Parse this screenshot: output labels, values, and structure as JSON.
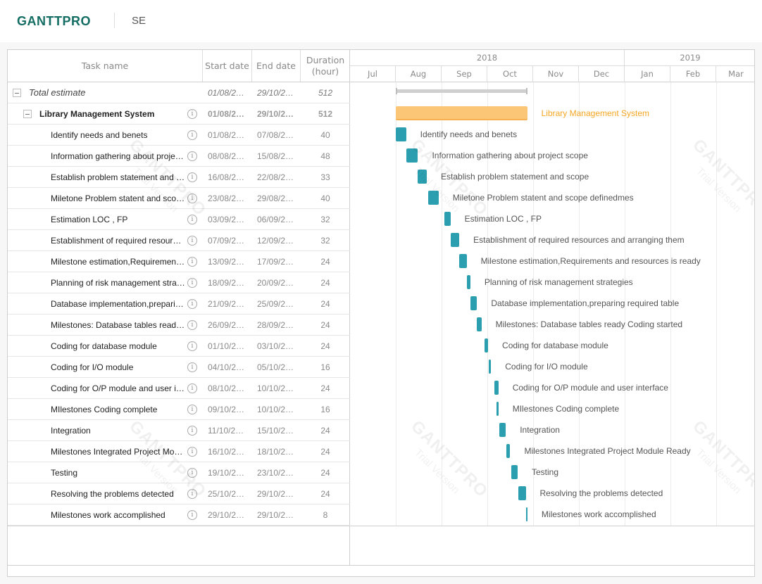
{
  "header": {
    "logo": "GANTTPRO",
    "project_code": "SE"
  },
  "columns": {
    "task_name": "Task name",
    "start_date": "Start date",
    "end_date": "End date",
    "duration_line1": "Duration",
    "duration_line2": "(hour)"
  },
  "timeline": {
    "years": [
      "2018",
      "2019"
    ],
    "months": [
      "Jul",
      "Aug",
      "Sep",
      "Oct",
      "Nov",
      "Dec",
      "Jan",
      "Feb",
      "Mar"
    ]
  },
  "rows": [
    {
      "name": "Total estimate",
      "start": "01/08/2…",
      "end": "29/10/2…",
      "duration": "512",
      "level": 0,
      "type": "total",
      "bar_start_day": 0,
      "bar_end_day": 89
    },
    {
      "name": "Library Management System",
      "start": "01/08/2…",
      "end": "29/10/2…",
      "duration": "512",
      "level": 1,
      "type": "project",
      "bar_label": "Library Management System",
      "bar_start_day": 0,
      "bar_end_day": 89
    },
    {
      "name": "Identify needs and benets",
      "start": "01/08/2…",
      "end": "07/08/2…",
      "duration": "40",
      "level": 2,
      "type": "task",
      "bar_label": "Identify needs and benets",
      "bar_start_day": 0,
      "bar_end_day": 7
    },
    {
      "name": "Information gathering about project scope",
      "start": "08/08/2…",
      "end": "15/08/2…",
      "duration": "48",
      "level": 2,
      "type": "task",
      "bar_label": "Information gathering about project scope",
      "bar_start_day": 7,
      "bar_end_day": 15
    },
    {
      "name": "Establish problem statement and scope",
      "start": "16/08/2…",
      "end": "22/08/2…",
      "duration": "33",
      "level": 2,
      "type": "task",
      "bar_label": "Establish problem statement and scope",
      "bar_start_day": 15,
      "bar_end_day": 21
    },
    {
      "name": "Miletone Problem statent and scope definedmes",
      "start": "23/08/2…",
      "end": "29/08/2…",
      "duration": "40",
      "level": 2,
      "type": "task",
      "bar_label": "Miletone Problem statent and scope definedmes",
      "bar_start_day": 22,
      "bar_end_day": 29
    },
    {
      "name": "Estimation LOC , FP",
      "start": "03/09/2…",
      "end": "06/09/2…",
      "duration": "32",
      "level": 2,
      "type": "task",
      "bar_label": "Estimation LOC , FP",
      "bar_start_day": 33,
      "bar_end_day": 37
    },
    {
      "name": "Establishment of required resources and arranging them",
      "start": "07/09/2…",
      "end": "12/09/2…",
      "duration": "32",
      "level": 2,
      "type": "task",
      "bar_label": "Establishment of required resources and arranging them",
      "bar_start_day": 37,
      "bar_end_day": 43
    },
    {
      "name": "Milestone estimation,Requirements and resources is ready",
      "start": "13/09/2…",
      "end": "17/09/2…",
      "duration": "24",
      "level": 2,
      "type": "task",
      "bar_label": "Milestone estimation,Requirements and resources is ready",
      "bar_start_day": 43,
      "bar_end_day": 48
    },
    {
      "name": "Planning of risk management strategies",
      "start": "18/09/2…",
      "end": "20/09/2…",
      "duration": "24",
      "level": 2,
      "type": "task",
      "bar_label": "Planning of risk management strategies",
      "bar_start_day": 48,
      "bar_end_day": 50.5
    },
    {
      "name": "Database implementation,preparing required table",
      "start": "21/09/2…",
      "end": "25/09/2…",
      "duration": "24",
      "level": 2,
      "type": "task",
      "bar_label": "Database implementation,preparing required table",
      "bar_start_day": 50.5,
      "bar_end_day": 55
    },
    {
      "name": "Milestones: Database tables ready Coding started",
      "start": "26/09/2…",
      "end": "28/09/2…",
      "duration": "24",
      "level": 2,
      "type": "task",
      "bar_label": "Milestones: Database tables ready Coding started",
      "bar_start_day": 55,
      "bar_end_day": 58
    },
    {
      "name": "Coding for database module",
      "start": "01/10/2…",
      "end": "03/10/2…",
      "duration": "24",
      "level": 2,
      "type": "task",
      "bar_label": "Coding for database module",
      "bar_start_day": 60,
      "bar_end_day": 62.5
    },
    {
      "name": "Coding for I/O module",
      "start": "04/10/2…",
      "end": "05/10/2…",
      "duration": "16",
      "level": 2,
      "type": "task",
      "bar_label": "Coding for I/O module",
      "bar_start_day": 63,
      "bar_end_day": 64.5
    },
    {
      "name": "Coding for O/P module and user interface",
      "start": "08/10/2…",
      "end": "10/10/2…",
      "duration": "24",
      "level": 2,
      "type": "task",
      "bar_label": "Coding for O/P module and user interface",
      "bar_start_day": 67,
      "bar_end_day": 69.5
    },
    {
      "name": "MIlestones Coding complete",
      "start": "09/10/2…",
      "end": "10/10/2…",
      "duration": "16",
      "level": 2,
      "type": "task",
      "bar_label": "MIlestones Coding complete",
      "bar_start_day": 68,
      "bar_end_day": 69.5
    },
    {
      "name": "Integration",
      "start": "11/10/2…",
      "end": "15/10/2…",
      "duration": "24",
      "level": 2,
      "type": "task",
      "bar_label": "Integration",
      "bar_start_day": 70,
      "bar_end_day": 74.5
    },
    {
      "name": "Milestones Integrated Project Module Ready",
      "start": "16/10/2…",
      "end": "18/10/2…",
      "duration": "24",
      "level": 2,
      "type": "task",
      "bar_label": "Milestones Integrated Project Module Ready",
      "bar_start_day": 75,
      "bar_end_day": 77.5
    },
    {
      "name": "Testing",
      "start": "19/10/2…",
      "end": "23/10/2…",
      "duration": "24",
      "level": 2,
      "type": "task",
      "bar_label": "Testing",
      "bar_start_day": 78,
      "bar_end_day": 82.5
    },
    {
      "name": "Resolving the problems detected",
      "start": "25/10/2…",
      "end": "29/10/2…",
      "duration": "24",
      "level": 2,
      "type": "task",
      "bar_label": "Resolving the problems detected",
      "bar_start_day": 83,
      "bar_end_day": 88
    },
    {
      "name": "Milestones work accomplished",
      "start": "29/10/2…",
      "end": "29/10/2…",
      "duration": "8",
      "level": 2,
      "type": "task",
      "bar_label": "Milestones work accomplished",
      "bar_start_day": 88.2,
      "bar_end_day": 89
    }
  ],
  "watermark": {
    "brand": "GANTTPRO",
    "subtitle": "Trial Version"
  },
  "colors": {
    "brand": "#136d63",
    "project_bar": "#fbc777",
    "task_bar": "#2b9fb0",
    "project_label": "#f5a623"
  }
}
